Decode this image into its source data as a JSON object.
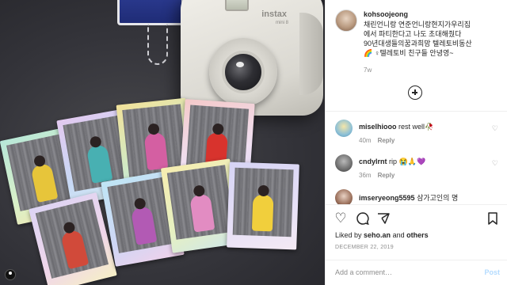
{
  "post": {
    "username": "kohsoojeong",
    "caption_lines": [
      "채린언니랑 연준언니랑현지가우리집",
      "에서 파티한다고 나도 초대해줬다",
      "90년대생들의꿈과희망 텔레토비동산",
      "🌈 ♀텔레토비 친구들 안녕영~"
    ],
    "time_ago": "7w"
  },
  "comments": [
    {
      "user": "miselhiooo",
      "text": "rest well🥀",
      "age": "40m",
      "reply": "Reply"
    },
    {
      "user": "cndylrnt",
      "text": "rip 😭🙏💜",
      "age": "36m",
      "reply": "Reply"
    },
    {
      "user": "imseryeong5595",
      "text": "삼가고인의 명",
      "age": "",
      "reply": ""
    }
  ],
  "actions": {
    "likes_prefix": "Liked by",
    "likes_user": "seho.an",
    "likes_and": "and",
    "likes_others": "others",
    "date": "DECEMBER 22, 2019"
  },
  "add_comment": {
    "placeholder": "Add a comment…",
    "post_label": "Post"
  },
  "icons": {
    "heart": "♡",
    "comment": "◯",
    "share": "➤",
    "save": "⌑",
    "plus": "add-icon"
  },
  "colors": {
    "link_blue_disabled": "#b3dbff",
    "muted": "#8e8e8e",
    "text": "#262626"
  }
}
